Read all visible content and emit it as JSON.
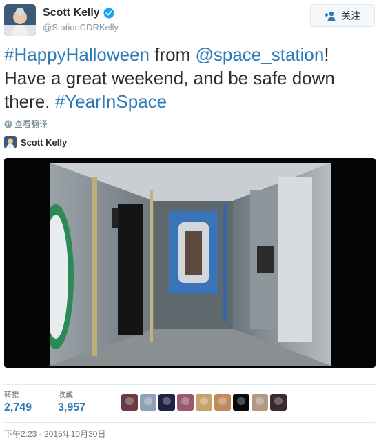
{
  "author": {
    "display_name": "Scott Kelly",
    "screen_name": "@StationCDRKelly",
    "verified": true
  },
  "follow_button": {
    "label": "关注",
    "icon": "follow-plus-icon"
  },
  "tweet": {
    "parts": [
      {
        "text": "#HappyHalloween",
        "link": true
      },
      {
        "text": " from ",
        "link": false
      },
      {
        "text": "@space_station",
        "link": true
      },
      {
        "text": "! Have a great weekend, and be safe down there. ",
        "link": false
      },
      {
        "text": "#YearInSpace",
        "link": true
      }
    ]
  },
  "translate": {
    "label": "查看翻译",
    "icon": "globe-icon"
  },
  "card": {
    "author_name": "Scott Kelly"
  },
  "media": {
    "description_icon": "video-still"
  },
  "stats": {
    "retweets_label": "转推",
    "retweets_value": "2,749",
    "likes_label": "收藏",
    "likes_value": "3,957"
  },
  "likers": [
    {
      "name": "liker-avatar-1",
      "color": "#6b3b45"
    },
    {
      "name": "liker-avatar-2",
      "color": "#8fa2b5"
    },
    {
      "name": "liker-avatar-3",
      "color": "#1f2244"
    },
    {
      "name": "liker-avatar-4",
      "color": "#9a5a6e"
    },
    {
      "name": "liker-avatar-5",
      "color": "#c9a26a"
    },
    {
      "name": "liker-avatar-6",
      "color": "#c08a5d"
    },
    {
      "name": "liker-avatar-7",
      "color": "#0a0a0a"
    },
    {
      "name": "liker-avatar-8",
      "color": "#b09a86"
    },
    {
      "name": "liker-avatar-9",
      "color": "#3a2a30"
    }
  ],
  "timestamp": "下午2:23 - 2015年10月30日",
  "colors": {
    "link": "#2b7bb9",
    "text": "#292f33",
    "muted": "#8899a6",
    "verified": "#1da1f2"
  }
}
